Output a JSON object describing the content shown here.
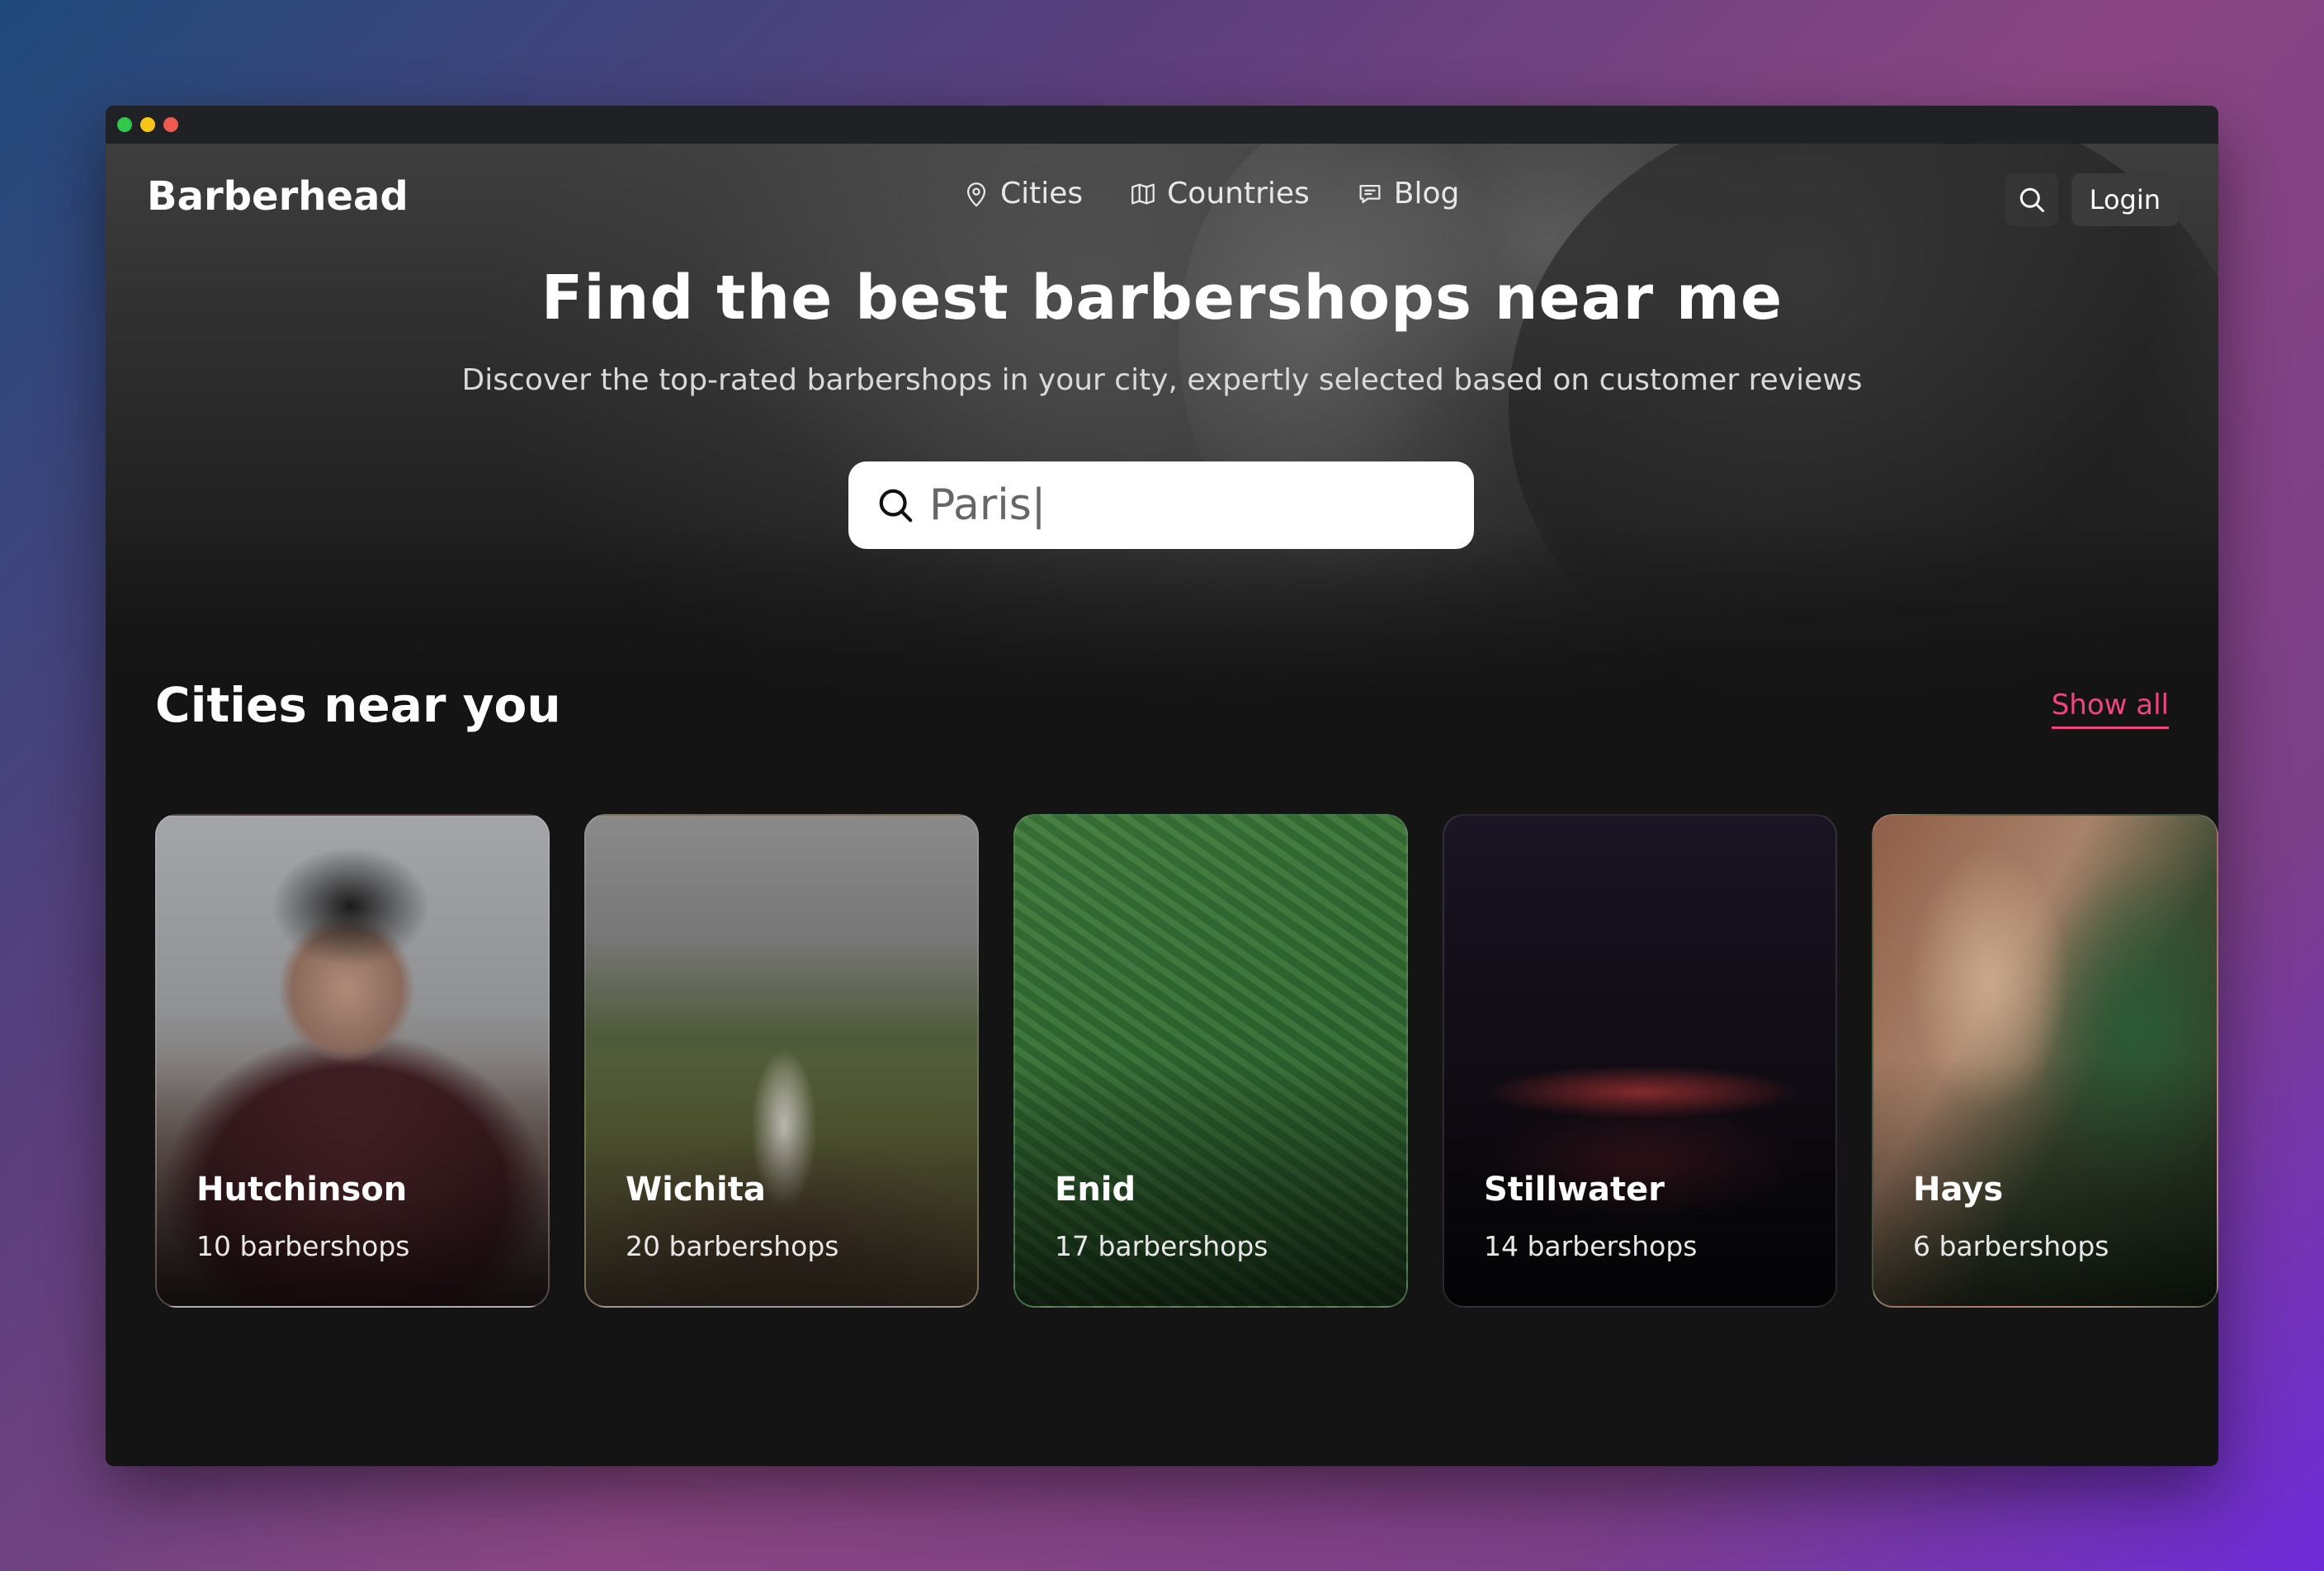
{
  "brand": "Barberhead",
  "nav": {
    "items": [
      {
        "label": "Cities",
        "icon": "map-pin-icon"
      },
      {
        "label": "Countries",
        "icon": "map-icon"
      },
      {
        "label": "Blog",
        "icon": "chat-icon"
      }
    ],
    "login_label": "Login"
  },
  "hero": {
    "title": "Find the best barbershops near me",
    "subtitle": "Discover the top-rated barbershops in your city, expertly selected based on customer reviews",
    "search_value": "Paris|"
  },
  "section": {
    "title": "Cities near you",
    "show_all": "Show all"
  },
  "cities": [
    {
      "name": "Hutchinson",
      "count": "10 barbershops"
    },
    {
      "name": "Wichita",
      "count": "20 barbershops"
    },
    {
      "name": "Enid",
      "count": "17 barbershops"
    },
    {
      "name": "Stillwater",
      "count": "14 barbershops"
    },
    {
      "name": "Hays",
      "count": "6 barbershops"
    }
  ],
  "colors": {
    "accent": "#f0467f",
    "window_bg": "#141414",
    "titlebar": "#202124",
    "dot_green": "#2ec94a",
    "dot_yellow": "#f5c518",
    "dot_red": "#ee5a4f"
  }
}
